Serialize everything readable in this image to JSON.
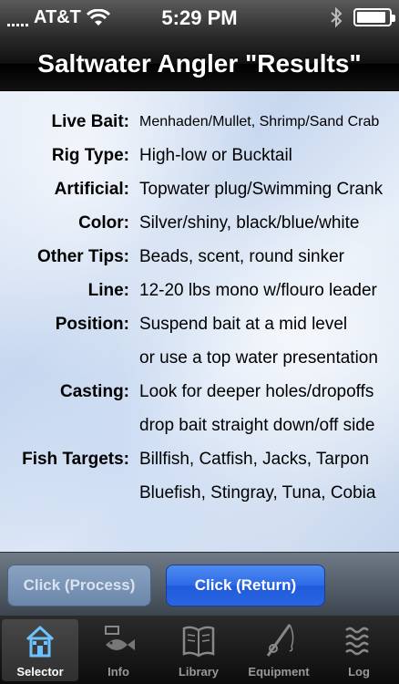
{
  "status": {
    "carrier": "AT&T",
    "time": "5:29 PM",
    "battery_level": 0.9
  },
  "title": "Saltwater Angler \"Results\"",
  "results": [
    {
      "label": "Live Bait:",
      "value": "Menhaden/Mullet, Shrimp/Sand Crab"
    },
    {
      "label": "Rig Type:",
      "value": "High-low or Bucktail"
    },
    {
      "label": "Artificial:",
      "value": "Topwater plug/Swimming Crank"
    },
    {
      "label": "Color:",
      "value": "Silver/shiny, black/blue/white"
    },
    {
      "label": "Other Tips:",
      "value": "Beads, scent, round sinker"
    },
    {
      "label": "Line:",
      "value": "12-20 lbs mono w/flouro leader"
    },
    {
      "label": "Position:",
      "value": "Suspend bait at a mid level"
    },
    {
      "label": "",
      "value": "or use a top water presentation"
    },
    {
      "label": "Casting:",
      "value": "Look for deeper holes/dropoffs"
    },
    {
      "label": "",
      "value": "drop bait straight down/off side"
    },
    {
      "label": "Fish Targets:",
      "value": "Billfish, Catfish, Jacks, Tarpon"
    },
    {
      "label": "",
      "value": "Bluefish, Stingray, Tuna, Cobia"
    }
  ],
  "buttons": {
    "process": "Click (Process)",
    "return": "Click (Return)"
  },
  "tabs": [
    {
      "label": "Selector",
      "icon": "house-icon",
      "active": true
    },
    {
      "label": "Info",
      "icon": "fish-icon",
      "active": false
    },
    {
      "label": "Library",
      "icon": "book-icon",
      "active": false
    },
    {
      "label": "Equipment",
      "icon": "fishing-rod-icon",
      "active": false
    },
    {
      "label": "Log",
      "icon": "waves-icon",
      "active": false
    }
  ],
  "colors": {
    "accent": "#2c6ae6",
    "title_bar": "#000000",
    "background": "#dfe8f6"
  }
}
